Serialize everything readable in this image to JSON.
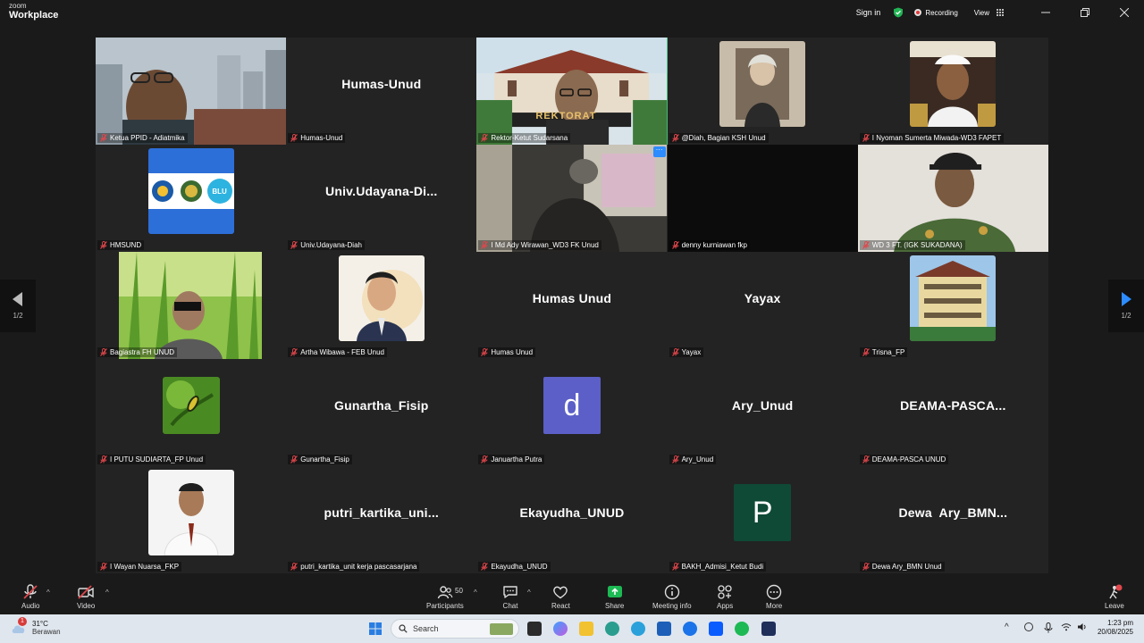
{
  "app": {
    "brand_line1": "zoom",
    "brand_line2": "Workplace",
    "sign_in": "Sign in",
    "recording": "Recording",
    "view": "View"
  },
  "participants": [
    {
      "label": "Ketua PPID - Adiatmika",
      "kind": "video"
    },
    {
      "label": "Humas-Unud",
      "name": "Humas-Unud",
      "kind": "name"
    },
    {
      "label": "Rektor-Ketut Sudarsana",
      "kind": "video",
      "active": true,
      "overlay_text": "REKTORAT"
    },
    {
      "label": "@Diah, Bagian KSH Unud",
      "kind": "photo"
    },
    {
      "label": "I Nyoman Sumerta Miwada-WD3 FAPET",
      "kind": "photo"
    },
    {
      "label": "HMSUND",
      "kind": "photo",
      "logo_text": "BLU"
    },
    {
      "label": "Univ.Udayana-Diah",
      "name": "Univ.Udayana-Di...",
      "kind": "name"
    },
    {
      "label": "I Md Ady Wirawan_WD3 FK Unud",
      "kind": "video"
    },
    {
      "label": "denny kurniawan fkp",
      "kind": "black"
    },
    {
      "label": "WD 3 FT. (IGK SUKADANA)",
      "kind": "video"
    },
    {
      "label": "Bagiastra FH UNUD",
      "kind": "video"
    },
    {
      "label": "Artha Wibawa - FEB Unud",
      "kind": "photo"
    },
    {
      "label": "Humas Unud",
      "name": "Humas Unud",
      "kind": "name"
    },
    {
      "label": "Yayax",
      "name": "Yayax",
      "kind": "name"
    },
    {
      "label": "Trisna_FP",
      "kind": "photo"
    },
    {
      "label": "I PUTU SUDIARTA_FP Unud",
      "kind": "photo"
    },
    {
      "label": "Gunartha_Fisip",
      "name": "Gunartha_Fisip",
      "kind": "name"
    },
    {
      "label": "Januartha Putra",
      "initial": "d",
      "kind": "initial",
      "color": "#5b5fc7"
    },
    {
      "label": "Ary_Unud",
      "name": "Ary_Unud",
      "kind": "name"
    },
    {
      "label": "DEAMA-PASCA UNUD",
      "name": "DEAMA-PASCA...",
      "kind": "name"
    },
    {
      "label": "I Wayan Nuarsa_FKP",
      "kind": "photo"
    },
    {
      "label": "putri_kartika_unit kerja pascasarjana",
      "name": "putri_kartika_uni...",
      "kind": "name"
    },
    {
      "label": "Ekayudha_UNUD",
      "name": "Ekayudha_UNUD",
      "kind": "name"
    },
    {
      "label": "BAKH_Admisi_Ketut Budi",
      "initial": "P",
      "kind": "initial",
      "color": "#0f4a36"
    },
    {
      "label": "Dewa Ary_BMN Unud",
      "name": "Dewa  Ary_BMN...",
      "kind": "name"
    }
  ],
  "pager": {
    "left": "1/2",
    "right": "1/2"
  },
  "toolbar": {
    "audio": "Audio",
    "video": "Video",
    "participants": "Participants",
    "participants_count": "50",
    "chat": "Chat",
    "react": "React",
    "share": "Share",
    "meeting_info": "Meeting info",
    "apps": "Apps",
    "more": "More",
    "leave": "Leave"
  },
  "colors": {
    "accent_green": "#2fbf71",
    "share_green": "#1db954",
    "mute_red": "#e0474c",
    "blu": "#2d6fd8"
  },
  "taskbar": {
    "weather_temp": "31°C",
    "weather_cond": "Berawan",
    "weather_badge": "1",
    "search_placeholder": "Search",
    "time": "1:23 pm",
    "date": "20/08/2025"
  }
}
